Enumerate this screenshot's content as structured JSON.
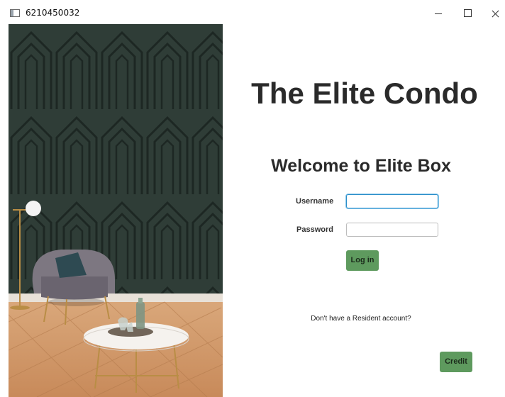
{
  "window": {
    "title": "6210450032"
  },
  "main": {
    "app_title": "The Elite Condo",
    "welcome": "Welcome to Elite Box",
    "username_label": "Username",
    "password_label": "Password",
    "username_value": "",
    "password_value": "",
    "login_label": "Log in",
    "signup_prompt": "Don't have a Resident account?",
    "credit_label": "Credit"
  },
  "colors": {
    "wallpaper": "#2f3d37",
    "button": "#5e9a5e",
    "focus_border": "#2b8ec9"
  }
}
